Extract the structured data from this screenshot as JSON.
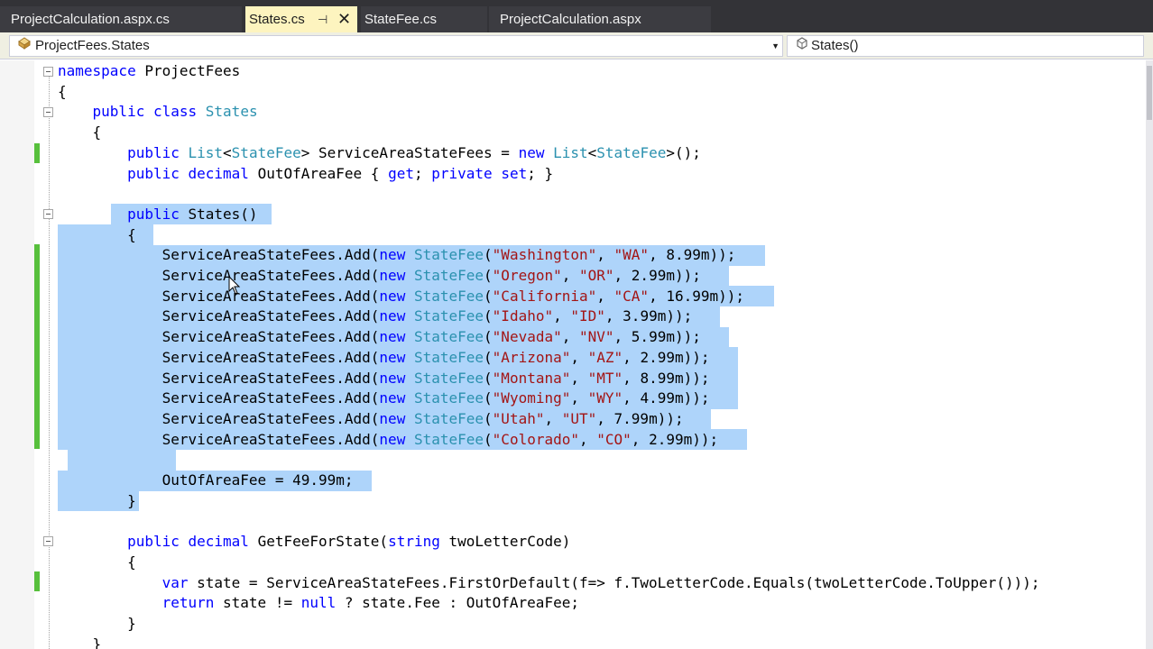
{
  "tabs": [
    {
      "label": "ProjectCalculation.aspx.cs"
    },
    {
      "label": "States.cs",
      "pin": "⊣",
      "close": "✕"
    },
    {
      "label": "StateFee.cs"
    },
    {
      "label": "ProjectCalculation.aspx"
    }
  ],
  "navigation": {
    "type_combo": {
      "icon": "class-icon",
      "text": "ProjectFees.States"
    },
    "member_combo": {
      "icon": "method-icon",
      "text": "States()"
    }
  },
  "code": {
    "lines": [
      [
        {
          "t": "namespace",
          "c": "kw"
        },
        {
          "t": " ProjectFees",
          "c": ""
        }
      ],
      [
        {
          "t": "{",
          "c": ""
        }
      ],
      [
        {
          "t": "    ",
          "c": ""
        },
        {
          "t": "public",
          "c": "kw"
        },
        {
          "t": " ",
          "c": ""
        },
        {
          "t": "class",
          "c": "kw"
        },
        {
          "t": " ",
          "c": ""
        },
        {
          "t": "States",
          "c": "ty"
        }
      ],
      [
        {
          "t": "    {",
          "c": ""
        }
      ],
      [
        {
          "t": "        ",
          "c": ""
        },
        {
          "t": "public",
          "c": "kw"
        },
        {
          "t": " ",
          "c": ""
        },
        {
          "t": "List",
          "c": "ty"
        },
        {
          "t": "<",
          "c": ""
        },
        {
          "t": "StateFee",
          "c": "ty"
        },
        {
          "t": "> ServiceAreaStateFees = ",
          "c": ""
        },
        {
          "t": "new",
          "c": "kw"
        },
        {
          "t": " ",
          "c": ""
        },
        {
          "t": "List",
          "c": "ty"
        },
        {
          "t": "<",
          "c": ""
        },
        {
          "t": "StateFee",
          "c": "ty"
        },
        {
          "t": ">();",
          "c": ""
        }
      ],
      [
        {
          "t": "        ",
          "c": ""
        },
        {
          "t": "public",
          "c": "kw"
        },
        {
          "t": " ",
          "c": ""
        },
        {
          "t": "decimal",
          "c": "kw"
        },
        {
          "t": " OutOfAreaFee { ",
          "c": ""
        },
        {
          "t": "get",
          "c": "kw"
        },
        {
          "t": "; ",
          "c": ""
        },
        {
          "t": "private",
          "c": "kw"
        },
        {
          "t": " ",
          "c": ""
        },
        {
          "t": "set",
          "c": "kw"
        },
        {
          "t": "; }",
          "c": ""
        }
      ],
      [
        {
          "t": "",
          "c": ""
        }
      ],
      [
        {
          "t": "        ",
          "c": ""
        },
        {
          "t": "public",
          "c": "kw"
        },
        {
          "t": " States()",
          "c": ""
        }
      ],
      [
        {
          "t": "        {",
          "c": ""
        }
      ],
      [
        {
          "t": "            ServiceAreaStateFees.Add(",
          "c": ""
        },
        {
          "t": "new",
          "c": "kw"
        },
        {
          "t": " ",
          "c": ""
        },
        {
          "t": "StateFee",
          "c": "ty"
        },
        {
          "t": "(",
          "c": ""
        },
        {
          "t": "\"Washington\"",
          "c": "st"
        },
        {
          "t": ", ",
          "c": ""
        },
        {
          "t": "\"WA\"",
          "c": "st"
        },
        {
          "t": ", 8.99m));",
          "c": ""
        }
      ],
      [
        {
          "t": "            ServiceAreaStateFees.Add(",
          "c": ""
        },
        {
          "t": "new",
          "c": "kw"
        },
        {
          "t": " ",
          "c": ""
        },
        {
          "t": "StateFee",
          "c": "ty"
        },
        {
          "t": "(",
          "c": ""
        },
        {
          "t": "\"Oregon\"",
          "c": "st"
        },
        {
          "t": ", ",
          "c": ""
        },
        {
          "t": "\"OR\"",
          "c": "st"
        },
        {
          "t": ", 2.99m));",
          "c": ""
        }
      ],
      [
        {
          "t": "            ServiceAreaStateFees.Add(",
          "c": ""
        },
        {
          "t": "new",
          "c": "kw"
        },
        {
          "t": " ",
          "c": ""
        },
        {
          "t": "StateFee",
          "c": "ty"
        },
        {
          "t": "(",
          "c": ""
        },
        {
          "t": "\"California\"",
          "c": "st"
        },
        {
          "t": ", ",
          "c": ""
        },
        {
          "t": "\"CA\"",
          "c": "st"
        },
        {
          "t": ", 16.99m));",
          "c": ""
        }
      ],
      [
        {
          "t": "            ServiceAreaStateFees.Add(",
          "c": ""
        },
        {
          "t": "new",
          "c": "kw"
        },
        {
          "t": " ",
          "c": ""
        },
        {
          "t": "StateFee",
          "c": "ty"
        },
        {
          "t": "(",
          "c": ""
        },
        {
          "t": "\"Idaho\"",
          "c": "st"
        },
        {
          "t": ", ",
          "c": ""
        },
        {
          "t": "\"ID\"",
          "c": "st"
        },
        {
          "t": ", 3.99m));",
          "c": ""
        }
      ],
      [
        {
          "t": "            ServiceAreaStateFees.Add(",
          "c": ""
        },
        {
          "t": "new",
          "c": "kw"
        },
        {
          "t": " ",
          "c": ""
        },
        {
          "t": "StateFee",
          "c": "ty"
        },
        {
          "t": "(",
          "c": ""
        },
        {
          "t": "\"Nevada\"",
          "c": "st"
        },
        {
          "t": ", ",
          "c": ""
        },
        {
          "t": "\"NV\"",
          "c": "st"
        },
        {
          "t": ", 5.99m));",
          "c": ""
        }
      ],
      [
        {
          "t": "            ServiceAreaStateFees.Add(",
          "c": ""
        },
        {
          "t": "new",
          "c": "kw"
        },
        {
          "t": " ",
          "c": ""
        },
        {
          "t": "StateFee",
          "c": "ty"
        },
        {
          "t": "(",
          "c": ""
        },
        {
          "t": "\"Arizona\"",
          "c": "st"
        },
        {
          "t": ", ",
          "c": ""
        },
        {
          "t": "\"AZ\"",
          "c": "st"
        },
        {
          "t": ", 2.99m));",
          "c": ""
        }
      ],
      [
        {
          "t": "            ServiceAreaStateFees.Add(",
          "c": ""
        },
        {
          "t": "new",
          "c": "kw"
        },
        {
          "t": " ",
          "c": ""
        },
        {
          "t": "StateFee",
          "c": "ty"
        },
        {
          "t": "(",
          "c": ""
        },
        {
          "t": "\"Montana\"",
          "c": "st"
        },
        {
          "t": ", ",
          "c": ""
        },
        {
          "t": "\"MT\"",
          "c": "st"
        },
        {
          "t": ", 8.99m));",
          "c": ""
        }
      ],
      [
        {
          "t": "            ServiceAreaStateFees.Add(",
          "c": ""
        },
        {
          "t": "new",
          "c": "kw"
        },
        {
          "t": " ",
          "c": ""
        },
        {
          "t": "StateFee",
          "c": "ty"
        },
        {
          "t": "(",
          "c": ""
        },
        {
          "t": "\"Wyoming\"",
          "c": "st"
        },
        {
          "t": ", ",
          "c": ""
        },
        {
          "t": "\"WY\"",
          "c": "st"
        },
        {
          "t": ", 4.99m));",
          "c": ""
        }
      ],
      [
        {
          "t": "            ServiceAreaStateFees.Add(",
          "c": ""
        },
        {
          "t": "new",
          "c": "kw"
        },
        {
          "t": " ",
          "c": ""
        },
        {
          "t": "StateFee",
          "c": "ty"
        },
        {
          "t": "(",
          "c": ""
        },
        {
          "t": "\"Utah\"",
          "c": "st"
        },
        {
          "t": ", ",
          "c": ""
        },
        {
          "t": "\"UT\"",
          "c": "st"
        },
        {
          "t": ", 7.99m));",
          "c": ""
        }
      ],
      [
        {
          "t": "            ServiceAreaStateFees.Add(",
          "c": ""
        },
        {
          "t": "new",
          "c": "kw"
        },
        {
          "t": " ",
          "c": ""
        },
        {
          "t": "StateFee",
          "c": "ty"
        },
        {
          "t": "(",
          "c": ""
        },
        {
          "t": "\"Colorado\"",
          "c": "st"
        },
        {
          "t": ", ",
          "c": ""
        },
        {
          "t": "\"CO\"",
          "c": "st"
        },
        {
          "t": ", 2.99m));",
          "c": ""
        }
      ],
      [
        {
          "t": "",
          "c": ""
        }
      ],
      [
        {
          "t": "            OutOfAreaFee = 49.99m;",
          "c": ""
        }
      ],
      [
        {
          "t": "        }",
          "c": ""
        }
      ],
      [
        {
          "t": "",
          "c": ""
        }
      ],
      [
        {
          "t": "        ",
          "c": ""
        },
        {
          "t": "public",
          "c": "kw"
        },
        {
          "t": " ",
          "c": ""
        },
        {
          "t": "decimal",
          "c": "kw"
        },
        {
          "t": " GetFeeForState(",
          "c": ""
        },
        {
          "t": "string",
          "c": "kw"
        },
        {
          "t": " twoLetterCode)",
          "c": ""
        }
      ],
      [
        {
          "t": "        {",
          "c": ""
        }
      ],
      [
        {
          "t": "            ",
          "c": ""
        },
        {
          "t": "var",
          "c": "kw"
        },
        {
          "t": " state = ServiceAreaStateFees.FirstOrDefault(f=> f.TwoLetterCode.Equals(twoLetterCode.ToUpper()));",
          "c": ""
        }
      ],
      [
        {
          "t": "            ",
          "c": ""
        },
        {
          "t": "return",
          "c": "kw"
        },
        {
          "t": " state != ",
          "c": ""
        },
        {
          "t": "null",
          "c": "kw"
        },
        {
          "t": " ? state.Fee : OutOfAreaFee;",
          "c": ""
        }
      ],
      [
        {
          "t": "        }",
          "c": ""
        }
      ],
      [
        {
          "t": "    }",
          "c": ""
        }
      ]
    ]
  }
}
